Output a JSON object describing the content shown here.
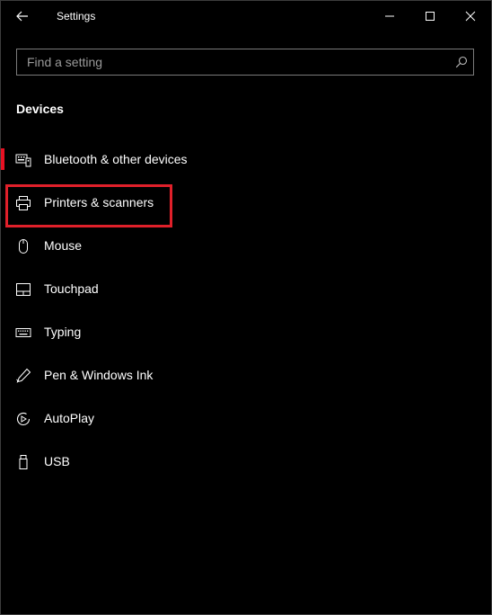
{
  "window": {
    "title": "Settings"
  },
  "search": {
    "placeholder": "Find a setting",
    "value": ""
  },
  "section": {
    "heading": "Devices"
  },
  "nav": {
    "items": [
      {
        "label": "Bluetooth & other devices",
        "icon": "bluetooth-devices-icon",
        "selected": true
      },
      {
        "label": "Printers & scanners",
        "icon": "printer-icon",
        "highlighted": true
      },
      {
        "label": "Mouse",
        "icon": "mouse-icon"
      },
      {
        "label": "Touchpad",
        "icon": "touchpad-icon"
      },
      {
        "label": "Typing",
        "icon": "keyboard-icon"
      },
      {
        "label": "Pen & Windows Ink",
        "icon": "pen-icon"
      },
      {
        "label": "AutoPlay",
        "icon": "autoplay-icon"
      },
      {
        "label": "USB",
        "icon": "usb-icon"
      }
    ]
  },
  "colors": {
    "background": "#000000",
    "text": "#ffffff",
    "accent": "#e81123",
    "highlight_border": "#e0202a"
  }
}
